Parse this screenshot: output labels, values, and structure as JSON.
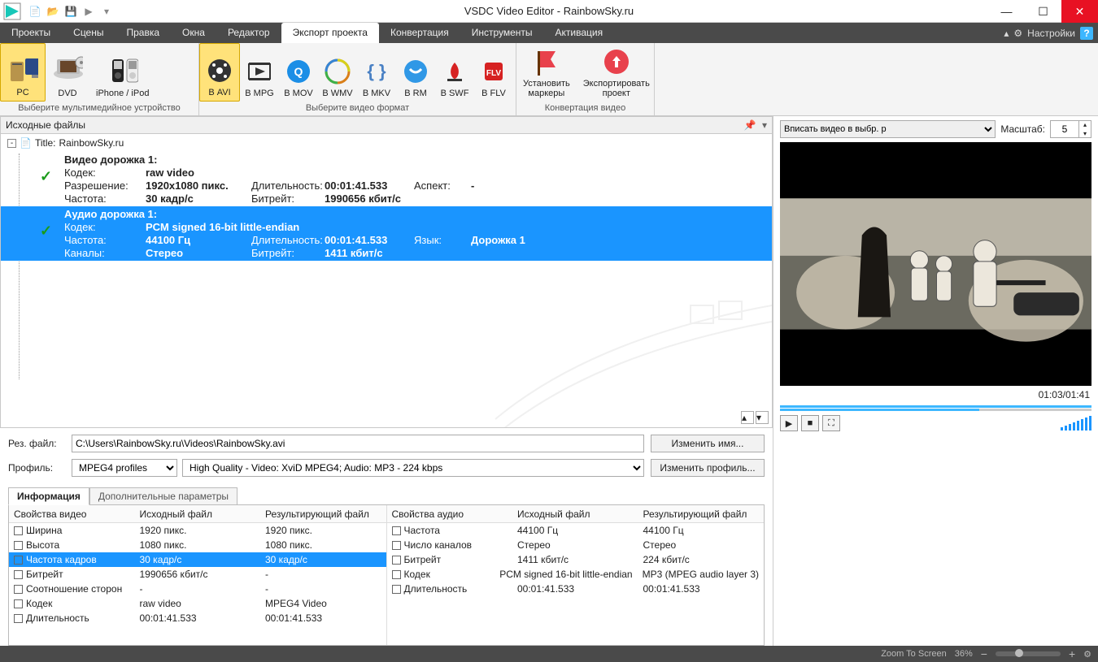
{
  "title": "VSDC Video Editor - RainbowSky.ru",
  "menu": {
    "items": [
      "Проекты",
      "Сцены",
      "Правка",
      "Окна",
      "Редактор",
      "Экспорт проекта",
      "Конвертация",
      "Инструменты",
      "Активация"
    ],
    "active": 5,
    "settings": "Настройки"
  },
  "ribbon": {
    "devices": {
      "caption": "Выберите мультимедийное устройство",
      "items": [
        "PC",
        "DVD",
        "iPhone / iPod"
      ],
      "sel": 0
    },
    "formats": {
      "caption": "Выберите видео формат",
      "items": [
        "В AVI",
        "В MPG",
        "В MOV",
        "В WMV",
        "В MKV",
        "В RM",
        "В SWF",
        "В FLV"
      ],
      "sel": 0
    },
    "convert": {
      "caption": "Конвертация видео",
      "markers": "Установить\nмаркеры",
      "export": "Экспортировать\nпроект"
    }
  },
  "sourcePanel": {
    "heading": "Исходные файлы",
    "titlePrefix": "Title: ",
    "titleValue": "RainbowSky.ru",
    "video": {
      "header": "Видео дорожка 1:",
      "Кодек:": "raw video",
      "Разрешение:": "1920x1080 пикс.",
      "Длительность:": "00:01:41.533",
      "Аспект:": "-",
      "Частота:": "30 кадр/с",
      "Битрейт:": "1990656 кбит/с"
    },
    "audio": {
      "header": "Аудио дорожка 1:",
      "Кодек:": "PCM signed 16-bit little-endian",
      "Частота:": "44100 Гц",
      "Длительность:": "00:01:41.533",
      "Язык:": "Дорожка 1",
      "Каналы:": "Стерео",
      "Битрейт:": "1411 кбит/с"
    }
  },
  "output": {
    "resLabel": "Рез. файл:",
    "resPath": "C:\\Users\\RainbowSky.ru\\Videos\\RainbowSky.avi",
    "changeName": "Изменить имя...",
    "profLabel": "Профиль:",
    "profile": "MPEG4 profiles",
    "preset": "High Quality - Video: XviD MPEG4; Audio: MP3 - 224 kbps",
    "changeProfile": "Изменить профиль..."
  },
  "tabs": {
    "info": "Информация",
    "extra": "Дополнительные параметры"
  },
  "videoTable": {
    "headers": [
      "Свойства видео",
      "Исходный файл",
      "Результирующий файл"
    ],
    "rows": [
      [
        "Ширина",
        "1920 пикс.",
        "1920 пикс."
      ],
      [
        "Высота",
        "1080 пикс.",
        "1080 пикс."
      ],
      [
        "Частота кадров",
        "30 кадр/с",
        "30 кадр/с"
      ],
      [
        "Битрейт",
        "1990656 кбит/с",
        "-"
      ],
      [
        "Соотношение сторон",
        "-",
        "-"
      ],
      [
        "Кодек",
        "raw video",
        "MPEG4 Video"
      ],
      [
        "Длительность",
        "00:01:41.533",
        "00:01:41.533"
      ]
    ],
    "selected": 2
  },
  "audioTable": {
    "headers": [
      "Свойства аудио",
      "Исходный файл",
      "Результирующий файл"
    ],
    "rows": [
      [
        "Частота",
        "44100 Гц",
        "44100 Гц"
      ],
      [
        "Число каналов",
        "Стерео",
        "Стерео"
      ],
      [
        "Битрейт",
        "1411 кбит/с",
        "224 кбит/с"
      ],
      [
        "Кодек",
        "PCM signed 16-bit little-endian",
        "MP3 (MPEG audio layer 3)"
      ],
      [
        "Длительность",
        "00:01:41.533",
        "00:01:41.533"
      ]
    ]
  },
  "preview": {
    "fitLabel": "Вписать видео в выбр. р",
    "scaleLabel": "Масштаб:",
    "scaleValue": "5",
    "timestamp": "01:03/01:41"
  },
  "status": {
    "zoom": "Zoom To Screen",
    "percent": "36%"
  }
}
